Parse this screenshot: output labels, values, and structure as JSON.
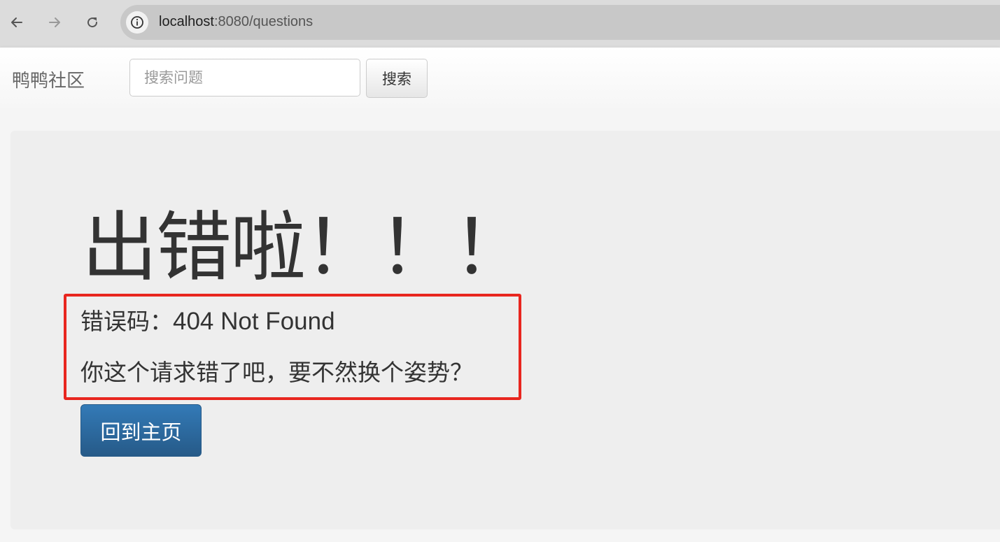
{
  "browser": {
    "url_host": "localhost",
    "url_rest": ":8080/questions",
    "icons": [
      "back-arrow-icon",
      "forward-arrow-icon",
      "reload-icon",
      "info-icon"
    ]
  },
  "navbar": {
    "brand": "鸭鸭社区",
    "search_placeholder": "搜索问题",
    "search_button": "搜索"
  },
  "error": {
    "heading": "出错啦！！！",
    "code_label": "错误码：",
    "code_value": "404 Not Found",
    "message": "你这个请求错了吧，要不然换个姿势？",
    "home_button": "回到主页"
  },
  "colors": {
    "primary_button": "#337ab7",
    "highlight_border": "#e8261f",
    "jumbotron_bg": "#eeeeee"
  }
}
